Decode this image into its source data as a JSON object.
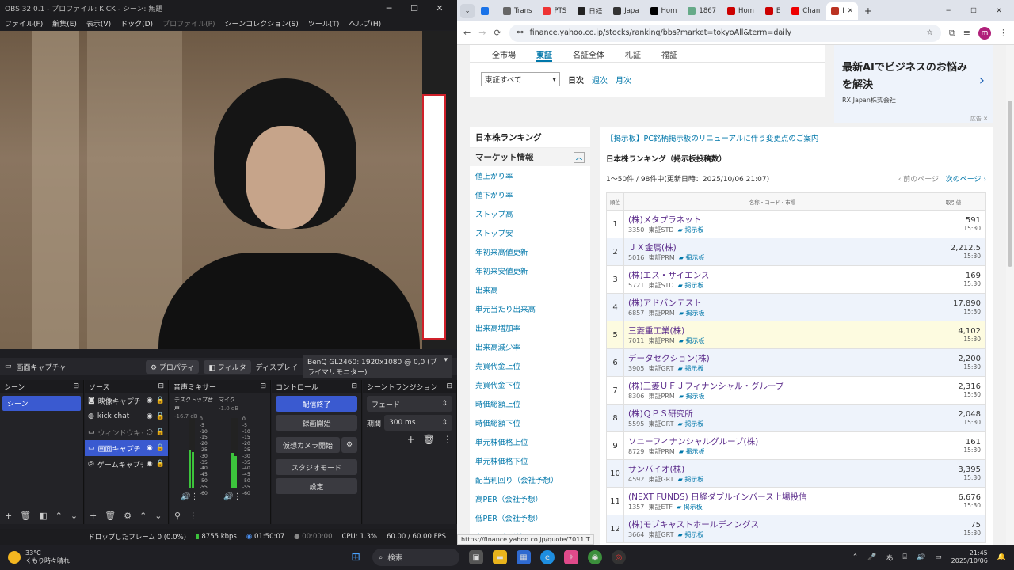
{
  "obs": {
    "title": "OBS 32.0.1 - プロファイル: KICK - シーン: 無題",
    "menu": [
      "ファイル(F)",
      "編集(E)",
      "表示(V)",
      "ドック(D)",
      "プロファイル(P)",
      "シーンコレクション(S)",
      "ツール(T)",
      "ヘルプ(H)"
    ],
    "props_bar": {
      "source_name": "画面キャプチャ",
      "properties": "プロパティ",
      "filters": "フィルタ",
      "display_label": "ディスプレイ",
      "display_value": "BenQ GL2460: 1920x1080 @ 0,0 (プライマリモニター)"
    },
    "docks": {
      "scenes": "シーン",
      "sources": "ソース",
      "mixer": "音声ミキサー",
      "controls": "コントロール",
      "transitions": "シーントランジション"
    },
    "scene_item": "シーン",
    "sources": [
      "映像キャプチ",
      "kick chat",
      "ウィンドウキャ",
      "画面キャプチ",
      "ゲームキャプチ"
    ],
    "mixer": {
      "ch1": {
        "name": "デスクトップ音声",
        "db": "-16.7 dB",
        "level": 0.55
      },
      "ch2": {
        "name": "マイク",
        "db": "-1.0 dB",
        "level": 0.5
      }
    },
    "scale": [
      "0",
      "-5",
      "-10",
      "-15",
      "-20",
      "-25",
      "-30",
      "-35",
      "-40",
      "-45",
      "-50",
      "-55",
      "-60"
    ],
    "controls": {
      "stop_stream": "配信終了",
      "start_record": "録画開始",
      "virtual_cam": "仮想カメラ開始",
      "studio_mode": "スタジオモード",
      "settings": "設定"
    },
    "transition": {
      "type": "フェード",
      "duration_label": "期間",
      "duration": "300 ms"
    },
    "status": {
      "dropped": "ドロップしたフレーム 0 (0.0%)",
      "bitrate": "8755 kbps",
      "live_time": "01:50:07",
      "rec_time": "00:00:00",
      "cpu": "CPU: 1.3%",
      "fps": "60.00 / 60.00 FPS"
    }
  },
  "chrome": {
    "tabs": [
      {
        "label": "",
        "color": "#1a73e8"
      },
      {
        "label": "Trans",
        "color": "#666"
      },
      {
        "label": "PTS",
        "color": "#e33"
      },
      {
        "label": "日経",
        "color": "#222"
      },
      {
        "label": "Japa",
        "color": "#333"
      },
      {
        "label": "Hom",
        "color": "#000"
      },
      {
        "label": "1867",
        "color": "#6a8"
      },
      {
        "label": "Hom",
        "color": "#c00"
      },
      {
        "label": "E",
        "color": "#c00"
      },
      {
        "label": "Chan",
        "color": "#e00"
      },
      {
        "label": "I",
        "color": "#b32",
        "active": true
      }
    ],
    "url": "finance.yahoo.co.jp/stocks/ranking/bbs?market=tokyoAll&term=daily",
    "profile": "m"
  },
  "page": {
    "market_tabs": [
      "全市場",
      "東証",
      "名証全体",
      "札証",
      "福証"
    ],
    "active_market": "東証",
    "market_select": "東証すべて",
    "terms": [
      "日次",
      "週次",
      "月次"
    ],
    "ad": {
      "text": "最新AIでビジネスのお悩みを解決",
      "company": "RX Japan株式会社",
      "label": "広告"
    },
    "sidebar": {
      "head": "日本株ランキング",
      "sub": "マーケット情報",
      "items": [
        "値上がり率",
        "値下がり率",
        "ストップ高",
        "ストップ安",
        "年初来高値更新",
        "年初来安値更新",
        "出来高",
        "単元当たり出来高",
        "出来高増加率",
        "出来高減少率",
        "売買代金上位",
        "売買代金下位",
        "時価総額上位",
        "時価総額下位",
        "単元株価格上位",
        "単元株価格下位",
        "配当利回り（会社予想）",
        "高PER（会社予想）",
        "低PER（会社予想）",
        "高PBR（実績）"
      ]
    },
    "notice": "【掲示板】PC銘柄掲示板のリニューアルに伴う変更点のご案内",
    "ranking_title": "日本株ランキング（掲示板投稿数）",
    "count": "1〜50件 / 98件中(更新日時：2025/10/06 21:07)",
    "prev": "前のページ",
    "next": "次のページ",
    "headers": {
      "rank": "順位",
      "name": "名称・コード・市場",
      "price": "取引値"
    },
    "bbs_label": "掲示板",
    "rows": [
      {
        "rank": "1",
        "name": "(株)メタプラネット",
        "code": "3350",
        "market": "東証STD",
        "price": "591",
        "time": "15:30"
      },
      {
        "rank": "2",
        "name": "ＪＸ金属(株)",
        "code": "5016",
        "market": "東証PRM",
        "price": "2,212.5",
        "time": "15:30"
      },
      {
        "rank": "3",
        "name": "(株)エス・サイエンス",
        "code": "5721",
        "market": "東証STD",
        "price": "169",
        "time": "15:30"
      },
      {
        "rank": "4",
        "name": "(株)アドバンテスト",
        "code": "6857",
        "market": "東証PRM",
        "price": "17,890",
        "time": "15:30"
      },
      {
        "rank": "5",
        "name": "三菱重工業(株)",
        "code": "7011",
        "market": "東証PRM",
        "price": "4,102",
        "time": "15:30"
      },
      {
        "rank": "6",
        "name": "データセクション(株)",
        "code": "3905",
        "market": "東証GRT",
        "price": "2,200",
        "time": "15:30"
      },
      {
        "rank": "7",
        "name": "(株)三菱ＵＦＪフィナンシャル・グループ",
        "code": "8306",
        "market": "東証PRM",
        "price": "2,316",
        "time": "15:30"
      },
      {
        "rank": "8",
        "name": "(株)ＱＰＳ研究所",
        "code": "5595",
        "market": "東証GRT",
        "price": "2,048",
        "time": "15:30"
      },
      {
        "rank": "9",
        "name": "ソニーフィナンシャルグループ(株)",
        "code": "8729",
        "market": "東証PRM",
        "price": "161",
        "time": "15:30"
      },
      {
        "rank": "10",
        "name": "サンバイオ(株)",
        "code": "4592",
        "market": "東証GRT",
        "price": "3,395",
        "time": "15:30"
      },
      {
        "rank": "11",
        "name": "(NEXT FUNDS) 日経ダブルインバース上場投信",
        "code": "1357",
        "market": "東証ETF",
        "price": "6,676",
        "time": "15:30"
      },
      {
        "rank": "12",
        "name": "(株)モブキャストホールディングス",
        "code": "3664",
        "market": "東証GRT",
        "price": "75",
        "time": "15:30"
      }
    ],
    "status_url": "https://finance.yahoo.co.jp/quote/7011.T"
  },
  "taskbar": {
    "temp": "33°C",
    "weather": "くもり時々晴れ",
    "search": "検索",
    "time": "21:45",
    "date": "2025/10/06",
    "ime": "あ"
  }
}
